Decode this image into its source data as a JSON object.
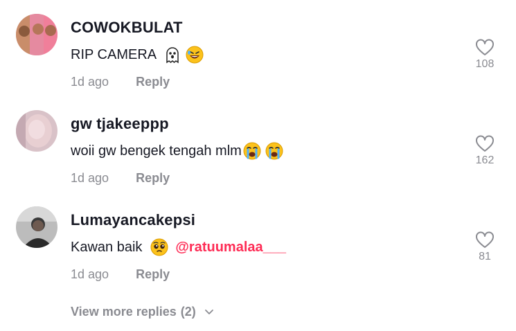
{
  "comments": [
    {
      "username": "COWOKBULAT",
      "text": "RIP CAMERA",
      "emojis": [
        "ghost-emoji",
        "rolling-on-floor-laughing-emoji"
      ],
      "time": "1d ago",
      "reply_label": "Reply",
      "likes": "108"
    },
    {
      "username": "gw tjakeeppp",
      "text": "woii gw bengek tengah mlm",
      "emojis": [
        "loudly-crying-face-emoji",
        "loudly-crying-face-emoji"
      ],
      "time": "1d ago",
      "reply_label": "Reply",
      "likes": "162"
    },
    {
      "username": "Lumayancakepsi",
      "text": "Kawan baik",
      "emojis": [
        "pleading-face-emoji"
      ],
      "mention": "@ratuumalaa___",
      "time": "1d ago",
      "reply_label": "Reply",
      "likes": "81"
    }
  ],
  "view_more": {
    "label": "View more replies",
    "count": "(2)"
  },
  "colors": {
    "text": "#161823",
    "muted": "#8a8b91",
    "mention": "#fe2c55"
  }
}
